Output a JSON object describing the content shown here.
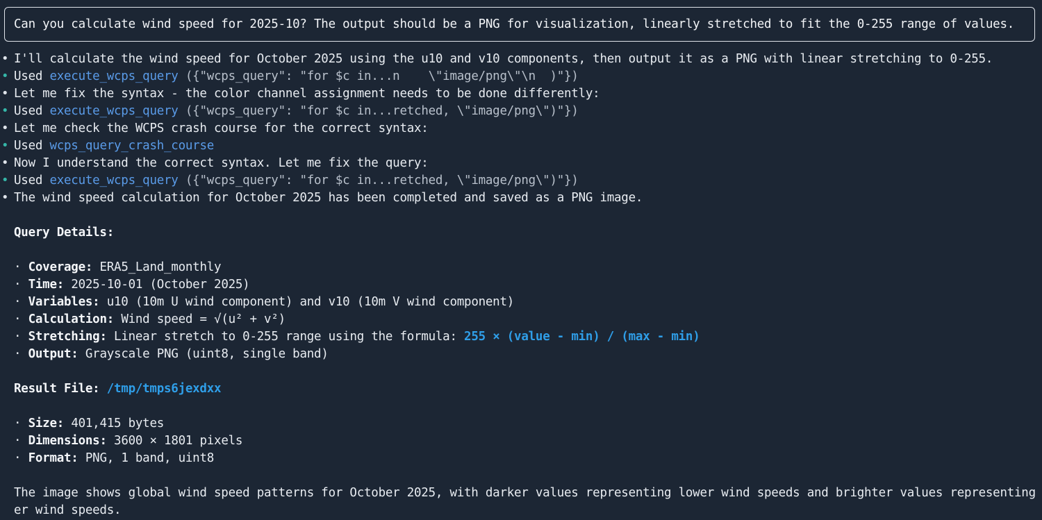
{
  "prompt": "Can you calculate wind speed for 2025-10? The output should be a PNG for visualization, linearly stretched to fit the 0-255 range of values.",
  "messages": {
    "m1": "I'll calculate the wind speed for October 2025 using the u10 and v10 components, then output it as a PNG with linear stretching to 0-255.",
    "t1_used": "Used ",
    "t1_tool": "execute_wcps_query",
    "t1_args": " ({\"wcps_query\": \"for $c in...n    \\\"image/png\\\"\\n  )\"})",
    "m2": "Let me fix the syntax - the color channel assignment needs to be done differently:",
    "t2_used": "Used ",
    "t2_tool": "execute_wcps_query",
    "t2_args": " ({\"wcps_query\": \"for $c in...retched, \\\"image/png\\\")\"})",
    "m3": "Let me check the WCPS crash course for the correct syntax:",
    "t3_used": "Used ",
    "t3_tool": "wcps_query_crash_course",
    "m4": "Now I understand the correct syntax. Let me fix the query:",
    "t4_used": "Used ",
    "t4_tool": "execute_wcps_query",
    "t4_args": " ({\"wcps_query\": \"for $c in...retched, \\\"image/png\\\")\"})",
    "m5": "The wind speed calculation for October 2025 has been completed and saved as a PNG image."
  },
  "details": {
    "heading": "Query Details:",
    "coverage_label": "Coverage:",
    "coverage_value": " ERA5_Land_monthly",
    "time_label": "Time:",
    "time_value": " 2025-10-01 (October 2025)",
    "variables_label": "Variables:",
    "variables_value": " u10 (10m U wind component) and v10 (10m V wind component)",
    "calc_label": "Calculation:",
    "calc_value": " Wind speed = √(u² + v²)",
    "stretch_label": "Stretching:",
    "stretch_value": " Linear stretch to 0-255 range using the formula: ",
    "stretch_formula": "255 × (value - min) / (max - min)",
    "output_label": "Output:",
    "output_value": " Grayscale PNG (uint8, single band)"
  },
  "result": {
    "label": "Result File: ",
    "path": "/tmp/tmps6jexdxx",
    "size_label": "Size:",
    "size_value": " 401,415 bytes",
    "dims_label": "Dimensions:",
    "dims_value": " 3600 × 1801 pixels",
    "format_label": "Format:",
    "format_value": " PNG, 1 band, uint8"
  },
  "summary": {
    "line1": "The image shows global wind speed patterns for October 2025, with darker values representing lower wind speeds and brighter values representing high",
    "line2": "er wind speeds."
  },
  "bullet": "•",
  "sub_bullet": "·",
  "colors": {
    "background": "#1c2634",
    "tool_link": "#5a9be8",
    "status_dot": "#35b6a8",
    "accent": "#2f9ee8"
  }
}
